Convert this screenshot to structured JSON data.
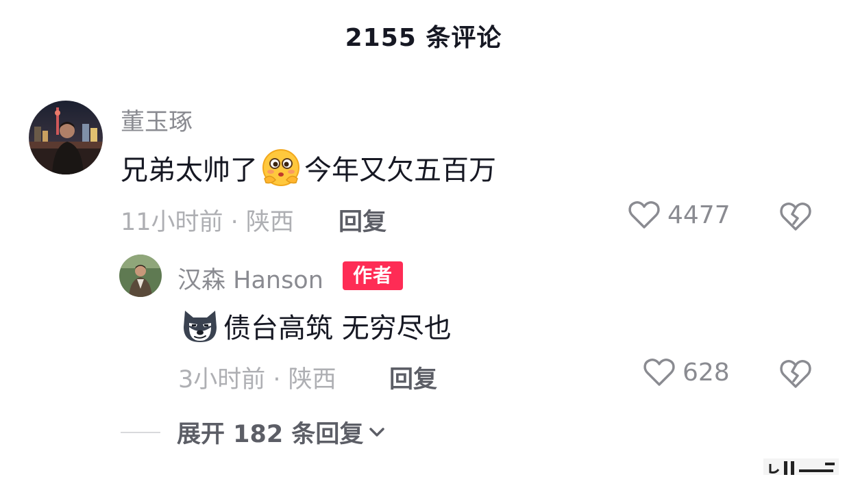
{
  "header": {
    "title": "2155 条评论"
  },
  "comment": {
    "username": "董玉琢",
    "text_before": "兄弟太帅了",
    "emoji_icon": "blushing-face-emoji",
    "text_after": "今年又欠五百万",
    "time_location": "11小时前 · 陕西",
    "reply_label": "回复",
    "like_count": "4477"
  },
  "reply": {
    "username": "汉森 Hanson",
    "badge": "作者",
    "emoji_icon": "smirking-dog-emoji",
    "text": "债台高筑 无穷尽也",
    "time_location": "3小时前 · 陕西",
    "reply_label": "回复",
    "like_count": "628"
  },
  "expand": {
    "label": "展开 182 条回复"
  },
  "colors": {
    "badge_bg": "#fe2c55",
    "text_primary": "#161823",
    "text_secondary": "#8a8b91",
    "text_meta": "#aeafb3"
  }
}
